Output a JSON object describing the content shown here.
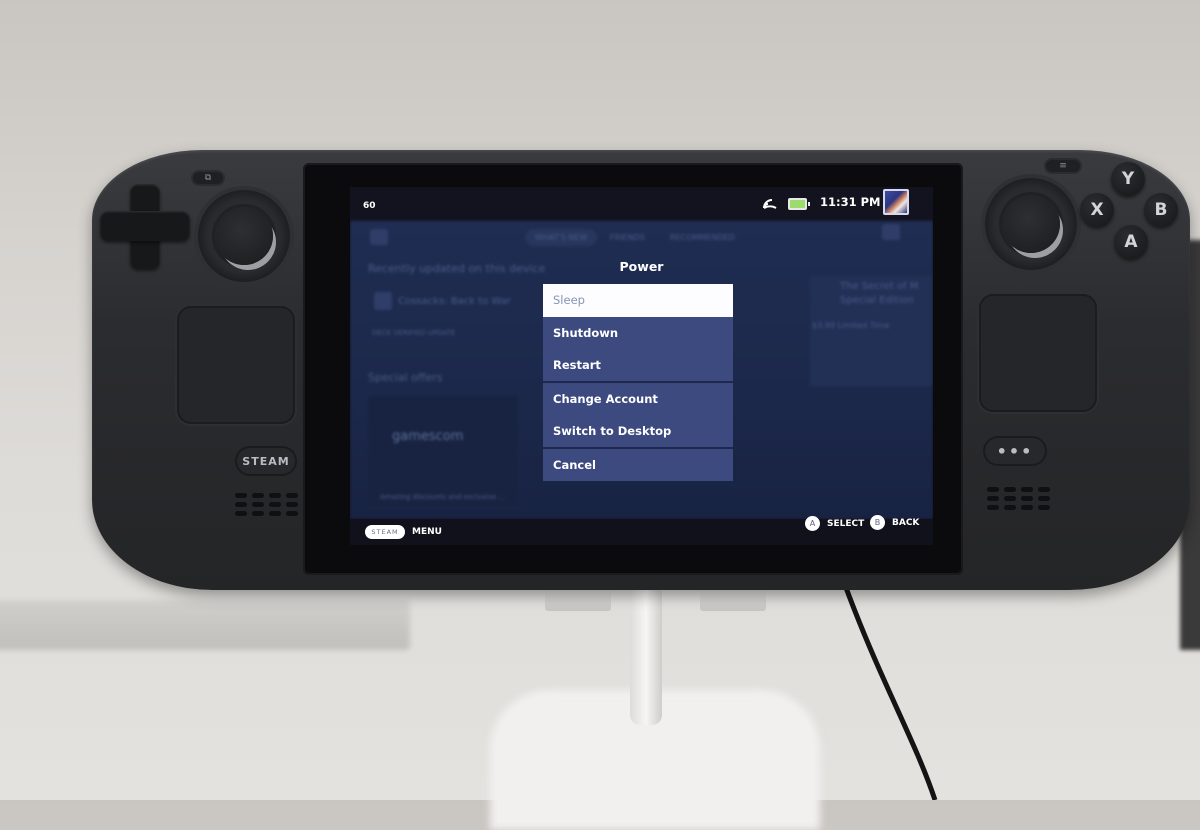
{
  "device": {
    "hardware_buttons": {
      "steam": "STEAM",
      "quick_access": "•••",
      "face": {
        "y": "Y",
        "x": "X",
        "b": "B",
        "a": "A"
      },
      "view": "⧉",
      "menu": "≡"
    }
  },
  "status_bar": {
    "fps": "60",
    "wifi_icon": "wifi-icon",
    "battery_icon": "battery-icon",
    "battery_color": "#9bdc6d",
    "time": "11:31 PM",
    "avatar_icon": "user-avatar"
  },
  "home_background": {
    "tabs": [
      "WHAT'S NEW",
      "FRIENDS",
      "RECOMMENDED"
    ],
    "section_recent": "Recently updated on this device",
    "recent_game": "Cossacks: Back to War",
    "recent_game_sub": "DECK VERIFIED UPDATE",
    "section_offers": "Special offers",
    "offer_banner": "gamescom",
    "offer_desc": "Amazing discounts and exclusive ...",
    "right_card_title": "The Secret of M",
    "right_card_sub": "Special Edition",
    "right_card_price": "$3.99  Limited Time"
  },
  "power_dialog": {
    "title": "Power",
    "items": [
      {
        "label": "Sleep",
        "focused": true
      },
      {
        "label": "Shutdown",
        "focused": false
      },
      {
        "label": "Restart",
        "focused": false
      },
      {
        "label": "Change Account",
        "focused": false
      },
      {
        "label": "Switch to Desktop",
        "focused": false
      },
      {
        "label": "Cancel",
        "focused": false
      }
    ],
    "accent_color": "#3c4a80"
  },
  "footer": {
    "steam_label": "STEAM",
    "menu_label": "MENU",
    "a_glyph": "A",
    "select_label": "SELECT",
    "b_glyph": "B",
    "back_label": "BACK"
  }
}
